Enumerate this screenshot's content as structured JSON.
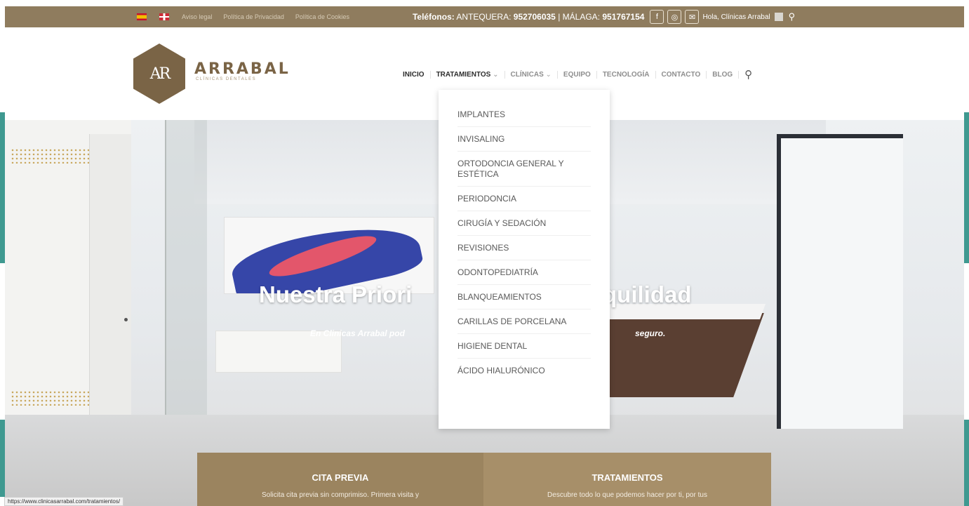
{
  "topbar": {
    "links": [
      "Aviso legal",
      "Política de Privacidad",
      "Política de Cookies"
    ],
    "phones_label": "Teléfonos:",
    "phones_antequera_label": "ANTEQUERA:",
    "phones_antequera_number": "952706035",
    "phones_sep": "|",
    "phones_malaga_label": "MÁLAGA:",
    "phones_malaga_number": "951767154",
    "social": [
      "f",
      "◎",
      "✉"
    ],
    "greeting": "Hola, Clínicas Arrabal",
    "icons": [
      "flag-es-icon",
      "flag-uk-icon",
      "facebook-icon",
      "instagram-icon",
      "mail-icon",
      "avatar-icon",
      "search-icon"
    ]
  },
  "header": {
    "logo_mark": "AR",
    "brand_name": "ARRABAL",
    "brand_sub": "CLÍNICAS DENTALES",
    "nav": [
      "INICIO",
      "TRATAMIENTOS",
      "CLÍNICAS",
      "EQUIPO",
      "TECNOLOGÍA",
      "CONTACTO",
      "BLOG"
    ],
    "dropdown_caret": "⌄"
  },
  "dropdown": {
    "items": [
      "IMPLANTES",
      "INVISALING",
      "ORTODONCIA GENERAL Y ESTÉTICA",
      "PERIODONCIA",
      "CIRUGÍA Y SEDACIÓN",
      "REVISIONES",
      "ODONTOPEDIATRÍA",
      "BLANQUEAMIENTOS",
      "CARILLAS DE PORCELANA",
      "HIGIENE DENTAL",
      "ÁCIDO HIALURÓNICO"
    ]
  },
  "hero": {
    "title_left": "Nuestra Priori",
    "title_right": "quilidad",
    "subtitle_left": "En Clinicas Arrabal pod",
    "subtitle_right": "seguro."
  },
  "cards": [
    {
      "title": "CITA PREVIA",
      "text": "Solicita cita previa sin comprimiso. Primera visita y"
    },
    {
      "title": "TRATAMIENTOS",
      "text": "Descubre todo lo que podemos hacer por ti, por tus"
    }
  ],
  "statusbar": {
    "url": "https://www.clinicasarrabal.com/tratamientos/"
  },
  "colors": {
    "brand_brown": "#8f7c5e",
    "teal": "#3f9990",
    "logo_brown": "#7a6446"
  }
}
